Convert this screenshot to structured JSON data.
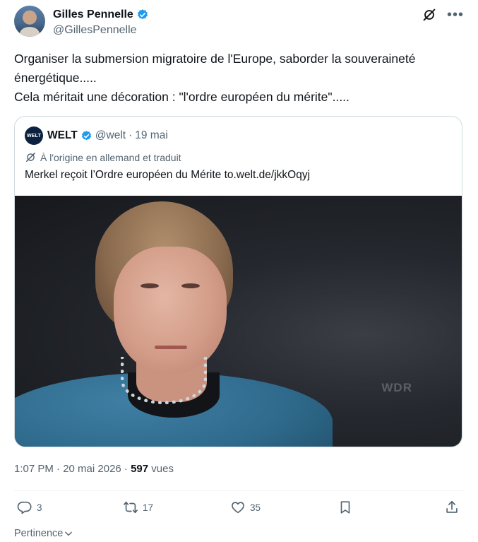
{
  "author": {
    "name": "Gilles Pennelle",
    "handle": "@GillesPennelle"
  },
  "tweet": {
    "text": "Organiser la submersion migratoire de l'Europe, saborder la souveraineté\nénergétique.....\nCela méritait une décoration : \"l'ordre européen du mérite\"....."
  },
  "quote": {
    "logo_text": "WELT",
    "name": "WELT",
    "handle": "@welt",
    "separator": "·",
    "date": "19 mai",
    "translated_label": "À l'origine en allemand et traduit",
    "text": "Merkel reçoit l’Ordre européen du Mérite to.welt.de/jkkOqyj",
    "media_sign": "WDR"
  },
  "meta": {
    "time": "1:07 PM · 20 mai 2026 · ",
    "views_count": "597",
    "views_label": " vues"
  },
  "actions": {
    "replies": "3",
    "reposts": "17",
    "likes": "35"
  },
  "sort": {
    "label": "Pertinence"
  },
  "icons": [
    "verified-badge-icon",
    "grok-icon",
    "more-icon",
    "translate-icon",
    "reply-icon",
    "repost-icon",
    "like-icon",
    "bookmark-icon",
    "share-icon",
    "chevron-down-icon"
  ],
  "colors": {
    "text": "#0f1419",
    "secondary": "#536471",
    "verified": "#1d9bf0",
    "border": "#cfd9de"
  }
}
